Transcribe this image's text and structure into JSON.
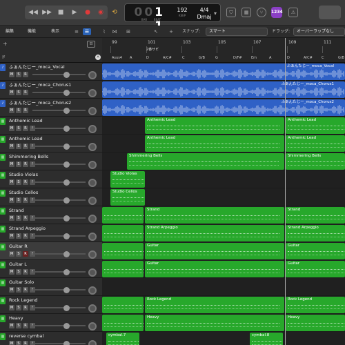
{
  "transport": {
    "rewind": "◀◀",
    "forward": "▶▶",
    "stop": "■",
    "play": "▶",
    "record": "●",
    "cycle_rec": "◉",
    "loop": "⟲"
  },
  "lcd": {
    "bar_dim": "00",
    "bar": "1",
    "beat": "1",
    "label_bar": "BAR",
    "label_beat": "BEAT",
    "tempo": "192",
    "tempo_label": "KEEP",
    "signature": "4/4",
    "key": "Dmaj",
    "key_icon": "▾"
  },
  "right_tools": {
    "badge": "1234",
    "tuner_icon": "tuner",
    "metronome_icon": "metronome"
  },
  "toolbar2": {
    "menus": [
      "編集",
      "機能",
      "表示"
    ],
    "snap_label": "スナップ:",
    "snap_value": "スマート",
    "drag_label": "ドラッグ:",
    "drag_value": "オーバーラップなし"
  },
  "ruler": {
    "bars": [
      "99",
      "101",
      "103",
      "105",
      "107",
      "109",
      "111"
    ],
    "marker": "2番サビ",
    "chords": [
      "Asus4",
      "A",
      "D",
      "A/C#",
      "C",
      "G/B",
      "G",
      "D/F#",
      "Em",
      "A",
      "D",
      "A/C#",
      "C",
      "G/B"
    ]
  },
  "tracks": [
    {
      "name": "ふぁんたじー_moca_Vocal",
      "type": "audio",
      "color": "#2f61c6",
      "regions": [
        {
          "label": "ふぁんたじー_moca_Vocal"
        }
      ]
    },
    {
      "name": "ふぁんたじー_moca_Chorus1",
      "type": "audio",
      "color": "#2f61c6",
      "regions": [
        {
          "label": "ふぁんたじー_moca_Chorus1"
        }
      ]
    },
    {
      "name": "ふぁんたじー_moca_Chorus2",
      "type": "audio",
      "color": "#2f61c6",
      "regions": [
        {
          "label": "ふぁんたじー_moca_Chorus2"
        }
      ]
    },
    {
      "name": "Anthemic Lead",
      "type": "midi",
      "color": "#27a82b",
      "regions": [
        {
          "label": "Anthemic Lead"
        },
        {
          "label": "Anthemic Lead"
        }
      ]
    },
    {
      "name": "Anthemic Lead",
      "type": "midi",
      "color": "#27a82b",
      "regions": [
        {
          "label": "Anthemic Lead"
        },
        {
          "label": "Anthemic Lead"
        }
      ]
    },
    {
      "name": "Shimmering Bells",
      "type": "midi",
      "color": "#27a82b",
      "regions": [
        {
          "label": "Shimmering Bells"
        },
        {
          "label": "Shimmering Bells"
        }
      ]
    },
    {
      "name": "Studio Violas",
      "type": "midi",
      "color": "#27a82b",
      "regions": [
        {
          "label": "Studio Violas"
        }
      ]
    },
    {
      "name": "Studio Cellos",
      "type": "midi",
      "color": "#27a82b",
      "regions": [
        {
          "label": "Studio Cellos"
        }
      ]
    },
    {
      "name": "Strand",
      "type": "midi",
      "color": "#27a82b",
      "regions": [
        {
          "label": ""
        },
        {
          "label": "Strand"
        },
        {
          "label": "Strand"
        }
      ]
    },
    {
      "name": "Strand Arpeggio",
      "type": "midi",
      "color": "#27a82b",
      "regions": [
        {
          "label": ""
        },
        {
          "label": "Strand Arpeggio"
        },
        {
          "label": "Strand Arpeggio"
        }
      ]
    },
    {
      "name": "Guitar R",
      "type": "midi",
      "color": "#27a82b",
      "regions": [
        {
          "label": ""
        },
        {
          "label": "Guitar"
        },
        {
          "label": "Guitar"
        }
      ]
    },
    {
      "name": "Guitar L",
      "type": "midi",
      "color": "#27a82b",
      "regions": [
        {
          "label": ""
        },
        {
          "label": "Guitar"
        },
        {
          "label": "Guitar"
        }
      ]
    },
    {
      "name": "Guitar Solo",
      "type": "midi",
      "color": "#27a82b",
      "regions": []
    },
    {
      "name": "Rock Legend",
      "type": "midi",
      "color": "#27a82b",
      "regions": [
        {
          "label": ""
        },
        {
          "label": "Rock Legend"
        },
        {
          "label": "Rock Legend"
        }
      ]
    },
    {
      "name": "Heavy",
      "type": "midi",
      "color": "#27a82b",
      "regions": [
        {
          "label": ""
        },
        {
          "label": "Heavy"
        },
        {
          "label": "Heavy"
        }
      ]
    },
    {
      "name": "reverse cymbal",
      "type": "midi",
      "color": "#27a82b",
      "regions": [
        {
          "label": "cymbal.7"
        },
        {
          "label": "cymbal.8"
        }
      ]
    }
  ],
  "msr": {
    "m": "M",
    "s": "S",
    "r": "R",
    "i": "I"
  }
}
